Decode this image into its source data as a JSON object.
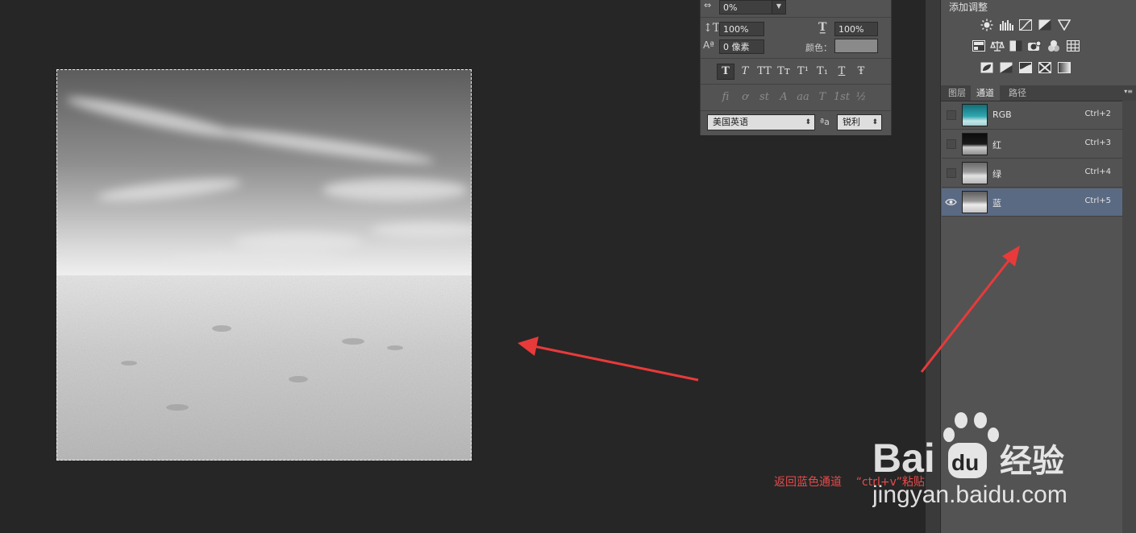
{
  "character_panel": {
    "tracking_value": "0%",
    "vertical_scale": "100%",
    "horizontal_scale": "100%",
    "baseline_shift": "0 像素",
    "color_label": "颜色：",
    "color_swatch": "#8a8a8a",
    "style_buttons": [
      "T",
      "T",
      "TT",
      "Tт",
      "T¹",
      "T₁",
      "T",
      "Ŧ"
    ],
    "opentype_buttons": [
      "fi",
      "ơ",
      "st",
      "A",
      "aa",
      "T",
      "1st",
      "½"
    ],
    "language": "美国英语",
    "antialias_icon_text": "ªa",
    "antialias": "锐利"
  },
  "adjustments": {
    "title": "添加调整"
  },
  "tabs": [
    {
      "label": "图层"
    },
    {
      "label": "通道"
    },
    {
      "label": "路径"
    }
  ],
  "channels": [
    {
      "name": "RGB",
      "shortcut": "Ctrl+2"
    },
    {
      "name": "红",
      "shortcut": "Ctrl+3"
    },
    {
      "name": "绿",
      "shortcut": "Ctrl+4"
    },
    {
      "name": "蓝",
      "shortcut": "Ctrl+5"
    }
  ],
  "annotation": {
    "caption": "返回蓝色通道    “ctrl+v”粘贴",
    "arrow_color": "#e83a3a"
  },
  "watermark": {
    "brand": "Bai",
    "brand_du": "du",
    "product": "经验",
    "url": "jingyan.baidu.com"
  }
}
